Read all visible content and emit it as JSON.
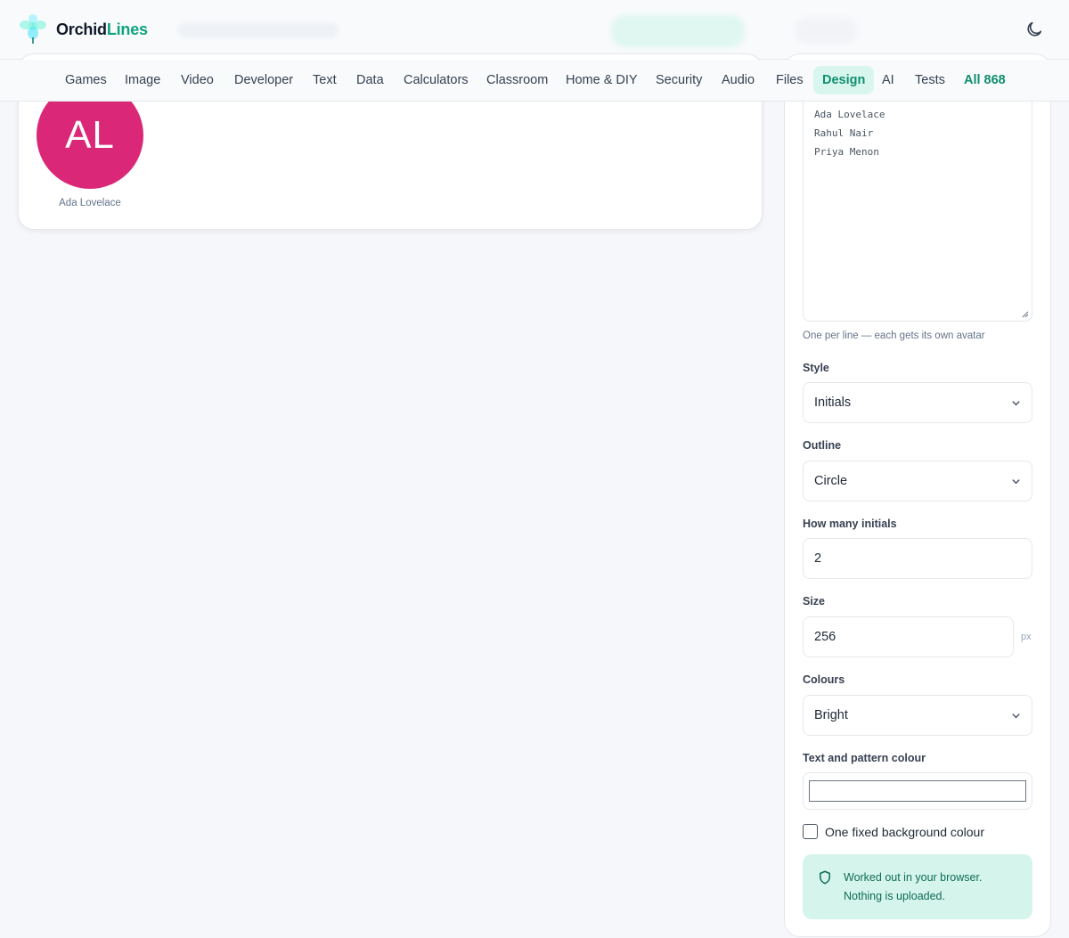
{
  "header": {
    "brand_part1": "Orchid",
    "brand_part2": "Lines",
    "icons": {
      "logo": "orchid-logo-icon",
      "theme_toggle": "moon-icon"
    },
    "accent_color": "#10a37f"
  },
  "nav": {
    "items": [
      {
        "label": "Games"
      },
      {
        "label": "Image"
      },
      {
        "label": "Video"
      },
      {
        "label": "Developer"
      },
      {
        "label": "Text"
      },
      {
        "label": "Data"
      },
      {
        "label": "Calculators"
      },
      {
        "label": "Classroom"
      },
      {
        "label": "Home & DIY"
      },
      {
        "label": "Security"
      },
      {
        "label": "Audio"
      },
      {
        "label": "Files"
      },
      {
        "label": "Design",
        "active": true
      },
      {
        "label": "AI"
      },
      {
        "label": "Tests"
      },
      {
        "label": "All 868"
      }
    ]
  },
  "preview": {
    "avatar_initials": "AL",
    "avatar_color": "#db2777",
    "avatar_name": "Ada Lovelace"
  },
  "settings": {
    "names": [
      "Ada Lovelace",
      "Rahul Nair",
      "Priya Menon"
    ],
    "names_hint": "One per line — each gets its own avatar",
    "style_label": "Style",
    "style_value": "Initials",
    "outline_label": "Outline",
    "outline_value": "Circle",
    "initials_label": "How many initials",
    "initials_value": "2",
    "size_label": "Size",
    "size_value": "256",
    "size_unit": "px",
    "colours_label": "Colours",
    "colours_value": "Bright",
    "text_colour_label": "Text and pattern colour",
    "text_colour_value": "#ffffff",
    "fixed_bg_label": "One fixed background colour",
    "fixed_bg_checked": false,
    "privacy_line1": "Worked out in your browser.",
    "privacy_line2": "Nothing is uploaded."
  }
}
